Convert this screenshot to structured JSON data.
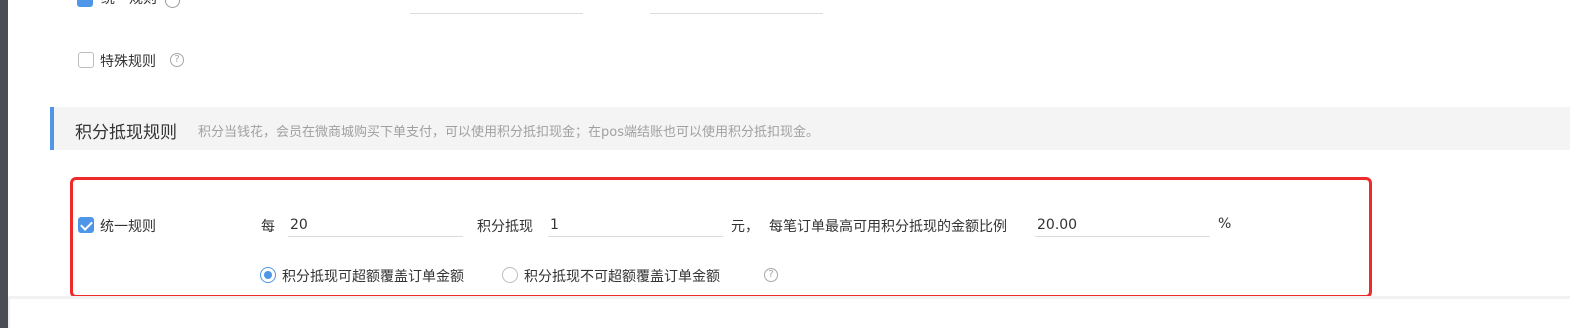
{
  "top_row": {
    "label": "统一规则"
  },
  "special_rule": {
    "label": "特殊规则",
    "help": "?"
  },
  "section": {
    "title": "积分抵现规则",
    "description": "积分当钱花，会员在微商城购买下单支付，可以使用积分抵扣现金；在pos端结账也可以使用积分抵扣现金。"
  },
  "unified_rule": {
    "label": "统一规则",
    "checked": true,
    "per_label": "每",
    "points_value": "20",
    "points_label": "积分抵现",
    "cash_value": "1",
    "yuan_label": "元，",
    "ratio_label": "每笔订单最高可用积分抵现的金额比例",
    "ratio_value": "20.00",
    "percent_label": "%"
  },
  "radio_options": [
    {
      "label": "积分抵现可超额覆盖订单金额",
      "selected": true
    },
    {
      "label": "积分抵现不可超额覆盖订单金额",
      "selected": false
    }
  ],
  "radio_help": "?",
  "colors": {
    "accent": "#4f95e8",
    "highlight_border": "#ee2b2b"
  }
}
